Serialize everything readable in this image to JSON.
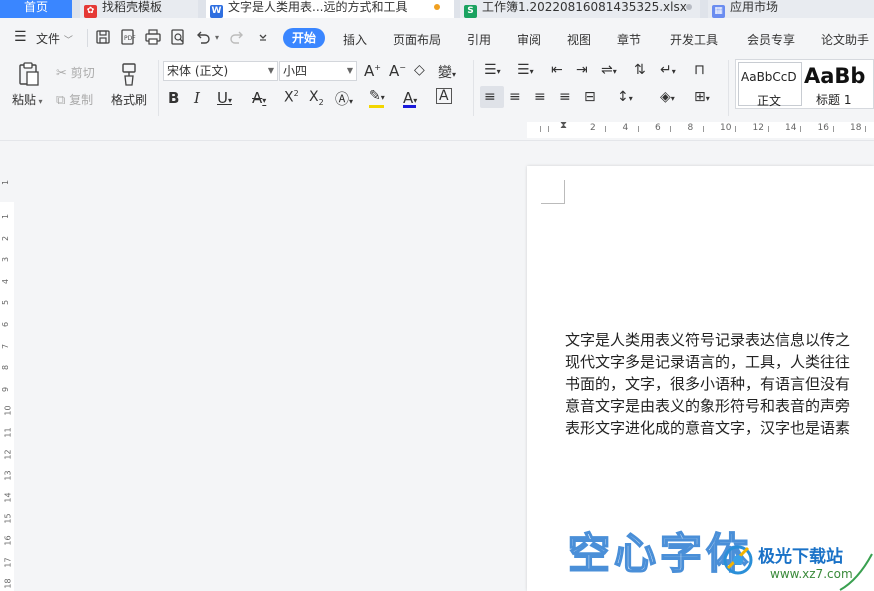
{
  "tabs": [
    {
      "label": "首页"
    },
    {
      "label": "找稻壳模板"
    },
    {
      "label": "文字是人类用表...远的方式和工具"
    },
    {
      "label": "工作簿1.20220816081435325.xlsx"
    },
    {
      "label": "应用市场"
    }
  ],
  "menu": {
    "file_label": "文件",
    "items": [
      "开始",
      "插入",
      "页面布局",
      "引用",
      "审阅",
      "视图",
      "章节",
      "开发工具",
      "会员专享",
      "论文助手"
    ]
  },
  "ribbon": {
    "paste": "粘贴",
    "cut": "剪切",
    "copy": "复制",
    "format_painter": "格式刷",
    "font_name": "宋体 (正文)",
    "font_size": "小四",
    "styles": [
      {
        "preview": "AaBbCcD",
        "name": "正文"
      },
      {
        "preview": "AaBb",
        "name": "标题 1"
      }
    ]
  },
  "ruler": {
    "h_numbers": [
      "2",
      "4",
      "6",
      "8",
      "10",
      "12",
      "14",
      "16",
      "18"
    ],
    "v_numbers": [
      "1",
      "1",
      "2",
      "3",
      "4",
      "5",
      "6",
      "7",
      "8",
      "9",
      "10",
      "11",
      "12",
      "13",
      "14",
      "15",
      "16",
      "17",
      "18"
    ]
  },
  "document": {
    "lines": [
      "文字是人类用表义符号记录表达信息以传之",
      "现代文字多是记录语言的，工具，人类往往",
      "书面的，文字，很多小语种，有语言但没有",
      "意音文字是由表义的象形符号和表音的声旁",
      "表形文字进化成的意音文字，汉字也是语素"
    ],
    "hollow_text": "空心字体"
  },
  "watermark": {
    "brand": "极光下载站",
    "url": "www.xz7.com"
  },
  "colors": {
    "accent": "#3a86ff",
    "highlight": "#f2d600",
    "font_color": "#1a1adb",
    "hollow_outline": "#4a8fd8"
  }
}
